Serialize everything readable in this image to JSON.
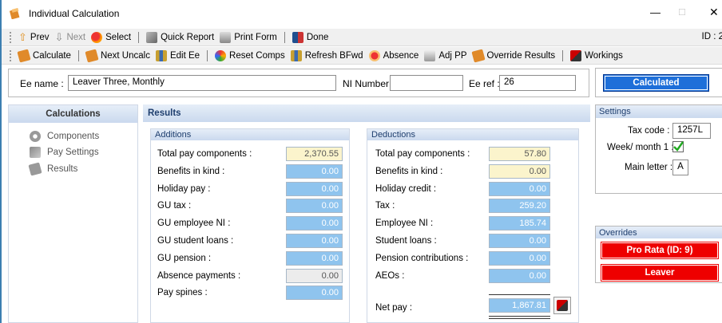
{
  "window": {
    "title": "Individual Calculation",
    "controls": {
      "minimize": "—",
      "maximize": "□",
      "close": "✕"
    }
  },
  "toolbar1": {
    "prev": "Prev",
    "next": "Next",
    "select": "Select",
    "quick_report": "Quick Report",
    "print_form": "Print Form",
    "done": "Done",
    "id_label": "ID : 2"
  },
  "toolbar2": {
    "calculate": "Calculate",
    "next_uncalc": "Next Uncalc",
    "edit_ee": "Edit Ee",
    "reset_comps": "Reset Comps",
    "refresh_bfwd": "Refresh BFwd",
    "absence": "Absence",
    "adj_pp": "Adj PP",
    "override_results": "Override Results",
    "workings": "Workings"
  },
  "employee": {
    "ee_name_label": "Ee name :",
    "ee_name_value": "Leaver Three, Monthly",
    "ni_number_label": "NI Number :",
    "ni_number_value": "",
    "ee_ref_label": "Ee ref :",
    "ee_ref_value": "26"
  },
  "status_button": "Calculated",
  "calculations_panel": {
    "title": "Calculations",
    "items": [
      "Components",
      "Pay Settings",
      "Results"
    ]
  },
  "results_title": "Results",
  "additions": {
    "title": "Additions",
    "rows": [
      {
        "label": "Total pay components :",
        "value": "2,370.55",
        "style": "yellow"
      },
      {
        "label": "Benefits in kind :",
        "value": "0.00",
        "style": "blue"
      },
      {
        "label": "Holiday pay :",
        "value": "0.00",
        "style": "blue"
      },
      {
        "label": "GU tax :",
        "value": "0.00",
        "style": "blue"
      },
      {
        "label": "GU employee NI :",
        "value": "0.00",
        "style": "blue"
      },
      {
        "label": "GU student loans :",
        "value": "0.00",
        "style": "blue"
      },
      {
        "label": "GU pension :",
        "value": "0.00",
        "style": "blue"
      },
      {
        "label": "Absence payments :",
        "value": "0.00",
        "style": "gray"
      },
      {
        "label": "Pay spines :",
        "value": "0.00",
        "style": "blue"
      }
    ]
  },
  "deductions": {
    "title": "Deductions",
    "rows": [
      {
        "label": "Total pay components :",
        "value": "57.80",
        "style": "yellow"
      },
      {
        "label": "Benefits in kind :",
        "value": "0.00",
        "style": "yellow"
      },
      {
        "label": "Holiday credit :",
        "value": "0.00",
        "style": "blue"
      },
      {
        "label": "Tax :",
        "value": "259.20",
        "style": "blue"
      },
      {
        "label": "Employee NI :",
        "value": "185.74",
        "style": "blue"
      },
      {
        "label": "Student loans :",
        "value": "0.00",
        "style": "blue"
      },
      {
        "label": "Pension contributions :",
        "value": "0.00",
        "style": "blue"
      },
      {
        "label": "AEOs :",
        "value": "0.00",
        "style": "blue"
      }
    ],
    "net_pay_label": "Net pay :",
    "net_pay_value": "1,867.81"
  },
  "settings": {
    "title": "Settings",
    "tax_code_label": "Tax code :",
    "tax_code_value": "1257L",
    "week_month_label": "Week/ month 1 :",
    "week_month_checked": true,
    "main_letter_label": "Main letter :",
    "main_letter_value": "A"
  },
  "overrides": {
    "title": "Overrides",
    "items": [
      "Pro Rata (ID: 9)",
      "Leaver"
    ]
  },
  "colors": {
    "accent": "#1e6fd9",
    "override_red": "#ee0000",
    "value_blue": "#8fc4ee",
    "value_yellow": "#fbf4cc"
  }
}
